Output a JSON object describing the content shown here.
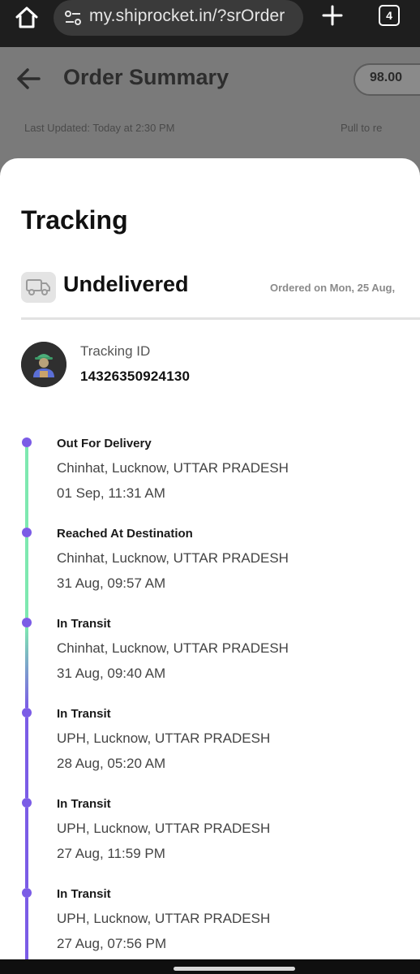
{
  "browser": {
    "url": "my.shiprocket.in/?srOrder",
    "tab_count": "4",
    "home_icon": "home-icon",
    "site_settings_icon": "tune-icon",
    "new_tab_icon": "plus-icon"
  },
  "background_page": {
    "title": "Order Summary",
    "amount": "98.00",
    "last_updated": "Last Updated: Today at 2:30 PM",
    "refresh_hint": "Pull to re"
  },
  "tracking": {
    "title": "Tracking",
    "status": "Undelivered",
    "ordered_on": "Ordered on Mon, 25 Aug,",
    "tracking_label": "Tracking ID",
    "tracking_id": "14326350924130",
    "events": [
      {
        "status": "Out For Delivery",
        "location": "Chinhat, Lucknow, UTTAR PRADESH",
        "time": "01 Sep, 11:31 AM"
      },
      {
        "status": "Reached At Destination",
        "location": "Chinhat, Lucknow, UTTAR PRADESH",
        "time": "31 Aug, 09:57 AM"
      },
      {
        "status": "In Transit",
        "location": "Chinhat, Lucknow, UTTAR PRADESH",
        "time": "31 Aug, 09:40 AM"
      },
      {
        "status": "In Transit",
        "location": "UPH, Lucknow, UTTAR PRADESH",
        "time": "28 Aug, 05:20 AM"
      },
      {
        "status": "In Transit",
        "location": "UPH, Lucknow, UTTAR PRADESH",
        "time": "27 Aug, 11:59 PM"
      },
      {
        "status": "In Transit",
        "location": "UPH, Lucknow, UTTAR PRADESH",
        "time": "27 Aug, 07:56 PM"
      }
    ]
  },
  "colors": {
    "timeline_green": "#7ee8b0",
    "timeline_purple": "#7b5ce6"
  }
}
